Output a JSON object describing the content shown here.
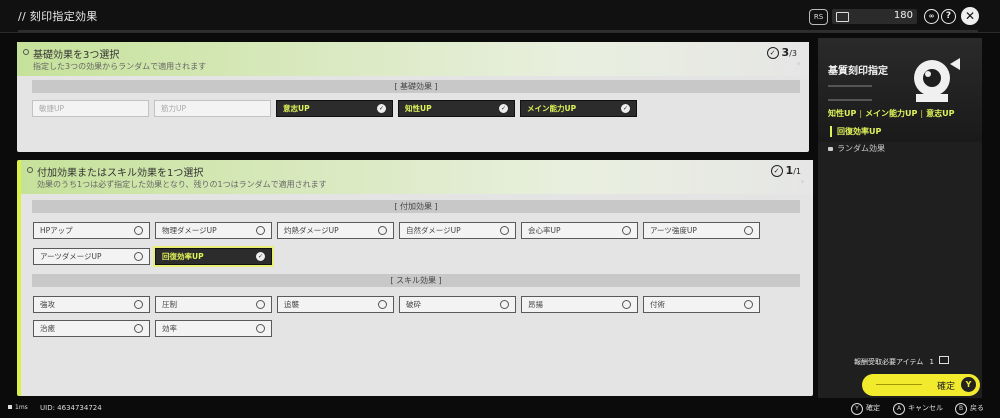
{
  "header": {
    "title": "// 刻印指定効果",
    "rs_label": "RS",
    "currency_value": "180",
    "help_label": "?",
    "close_label": "✕"
  },
  "section1": {
    "title": "基礎効果を3つ選択",
    "subtitle": "指定した3つの効果からランダムで適用されます",
    "count": "3",
    "count_total": "/3",
    "group_label": "[ 基礎効果 ]",
    "options": [
      {
        "label": "敏捷UP",
        "state": "disabled"
      },
      {
        "label": "筋力UP",
        "state": "disabled"
      },
      {
        "label": "意志UP",
        "state": "selected"
      },
      {
        "label": "知性UP",
        "state": "selected"
      },
      {
        "label": "メイン能力UP",
        "state": "selected"
      }
    ]
  },
  "section2": {
    "title": "付加効果またはスキル効果を1つ選択",
    "subtitle": "効果のうち1つは必ず指定した効果となり、残りの1つはランダムで適用されます",
    "count": "1",
    "count_total": "/1",
    "group_label_additional": "[ 付加効果 ]",
    "group_label_skill": "[ スキル効果 ]",
    "additional_options": [
      {
        "label": "HPアップ",
        "state": "normal"
      },
      {
        "label": "物理ダメージUP",
        "state": "normal"
      },
      {
        "label": "灼熱ダメージUP",
        "state": "normal"
      },
      {
        "label": "自然ダメージUP",
        "state": "normal"
      },
      {
        "label": "会心率UP",
        "state": "normal"
      },
      {
        "label": "アーツ強度UP",
        "state": "normal"
      },
      {
        "label": "アーツダメージUP",
        "state": "normal"
      },
      {
        "label": "回復効率UP",
        "state": "selected"
      }
    ],
    "skill_options": [
      {
        "label": "強攻",
        "state": "normal"
      },
      {
        "label": "圧制",
        "state": "normal"
      },
      {
        "label": "追襲",
        "state": "normal"
      },
      {
        "label": "破砕",
        "state": "normal"
      },
      {
        "label": "昂揚",
        "state": "normal"
      },
      {
        "label": "付術",
        "state": "normal"
      },
      {
        "label": "治癒",
        "state": "normal"
      },
      {
        "label": "効率",
        "state": "normal"
      }
    ]
  },
  "sidebar": {
    "title": "基質刻印指定",
    "tags": [
      "知性UP",
      "メイン能力UP",
      "意志UP"
    ],
    "tag_secondary": "回復効率UP",
    "random_label": "ランダム効果",
    "required_label": "報酬受取必要アイテム",
    "required_count": "1"
  },
  "confirm": {
    "label": "確定",
    "key": "Y"
  },
  "footer": {
    "fps": "1ms",
    "uid": "UID: 4634734724",
    "hints": [
      {
        "key": "Y",
        "label": "確定"
      },
      {
        "key": "A",
        "label": "キャンセル"
      },
      {
        "key": "B",
        "label": "戻る"
      }
    ]
  },
  "colors": {
    "accent": "#dff35a",
    "confirm_bg": "#f2ea2c",
    "panel_bg": "#e4e4e4",
    "selected_bg": "#2c2c2c"
  }
}
